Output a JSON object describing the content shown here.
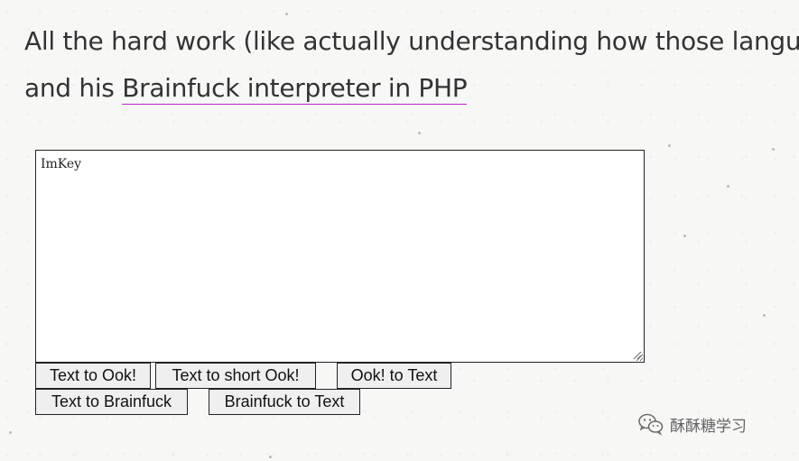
{
  "article": {
    "line1": "All the hard work (like actually understanding how those languages work)",
    "line2_prefix": "and his ",
    "link_text": "Brainfuck interpreter in PHP"
  },
  "editor": {
    "value": "ImKey"
  },
  "buttons": {
    "text_to_ook": "Text to Ook!",
    "text_to_short_ook": "Text to short Ook!",
    "ook_to_text": "Ook! to Text",
    "text_to_brainfuck": "Text to Brainfuck",
    "brainfuck_to_text": "Brainfuck to Text"
  },
  "watermark": {
    "icon": "wechat-icon",
    "text": "酥酥糖学习"
  },
  "colors": {
    "text": "#333333",
    "link_underline": "#c126c9",
    "button_bg": "#efefef",
    "page_bg": "#f7f7f6"
  }
}
